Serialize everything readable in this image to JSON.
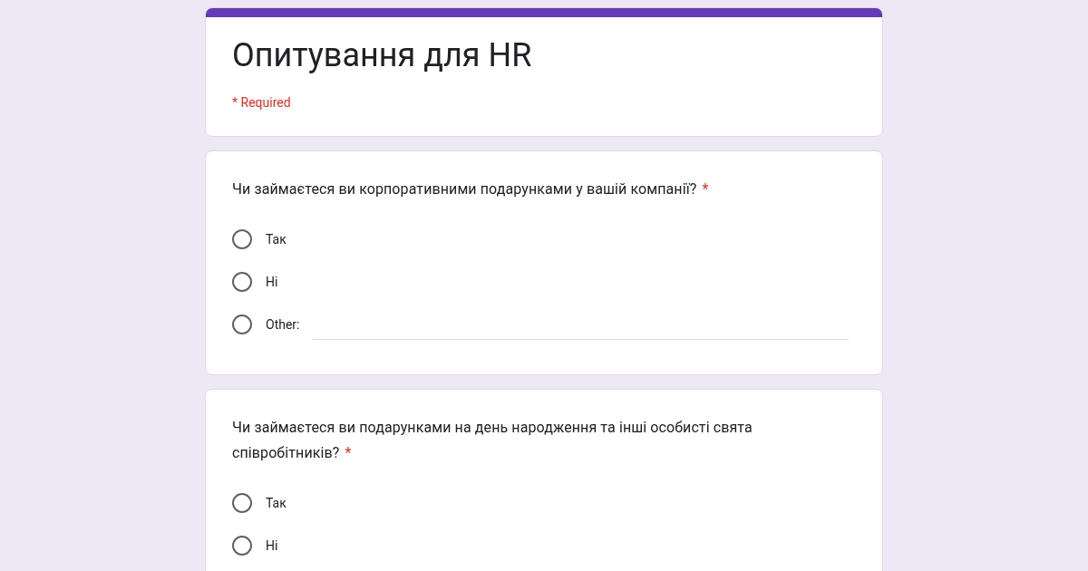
{
  "form": {
    "title": "Опитування для HR",
    "required_note": "* Required"
  },
  "questions": [
    {
      "text": "Чи займаєтеся ви корпоративними подарунками у вашій компанії?",
      "required_mark": "*",
      "options": [
        {
          "kind": "choice",
          "label": "Так",
          "selected": false
        },
        {
          "kind": "choice",
          "label": "Ні",
          "selected": false
        },
        {
          "kind": "other",
          "label": "Other:",
          "selected": false
        }
      ]
    },
    {
      "text": "Чи займаєтеся ви подарунками на день народження та інші особисті свята співробітників?",
      "required_mark": "*",
      "options": [
        {
          "kind": "choice",
          "label": "Так",
          "selected": false
        },
        {
          "kind": "choice",
          "label": "Ні",
          "selected": false
        }
      ]
    }
  ]
}
